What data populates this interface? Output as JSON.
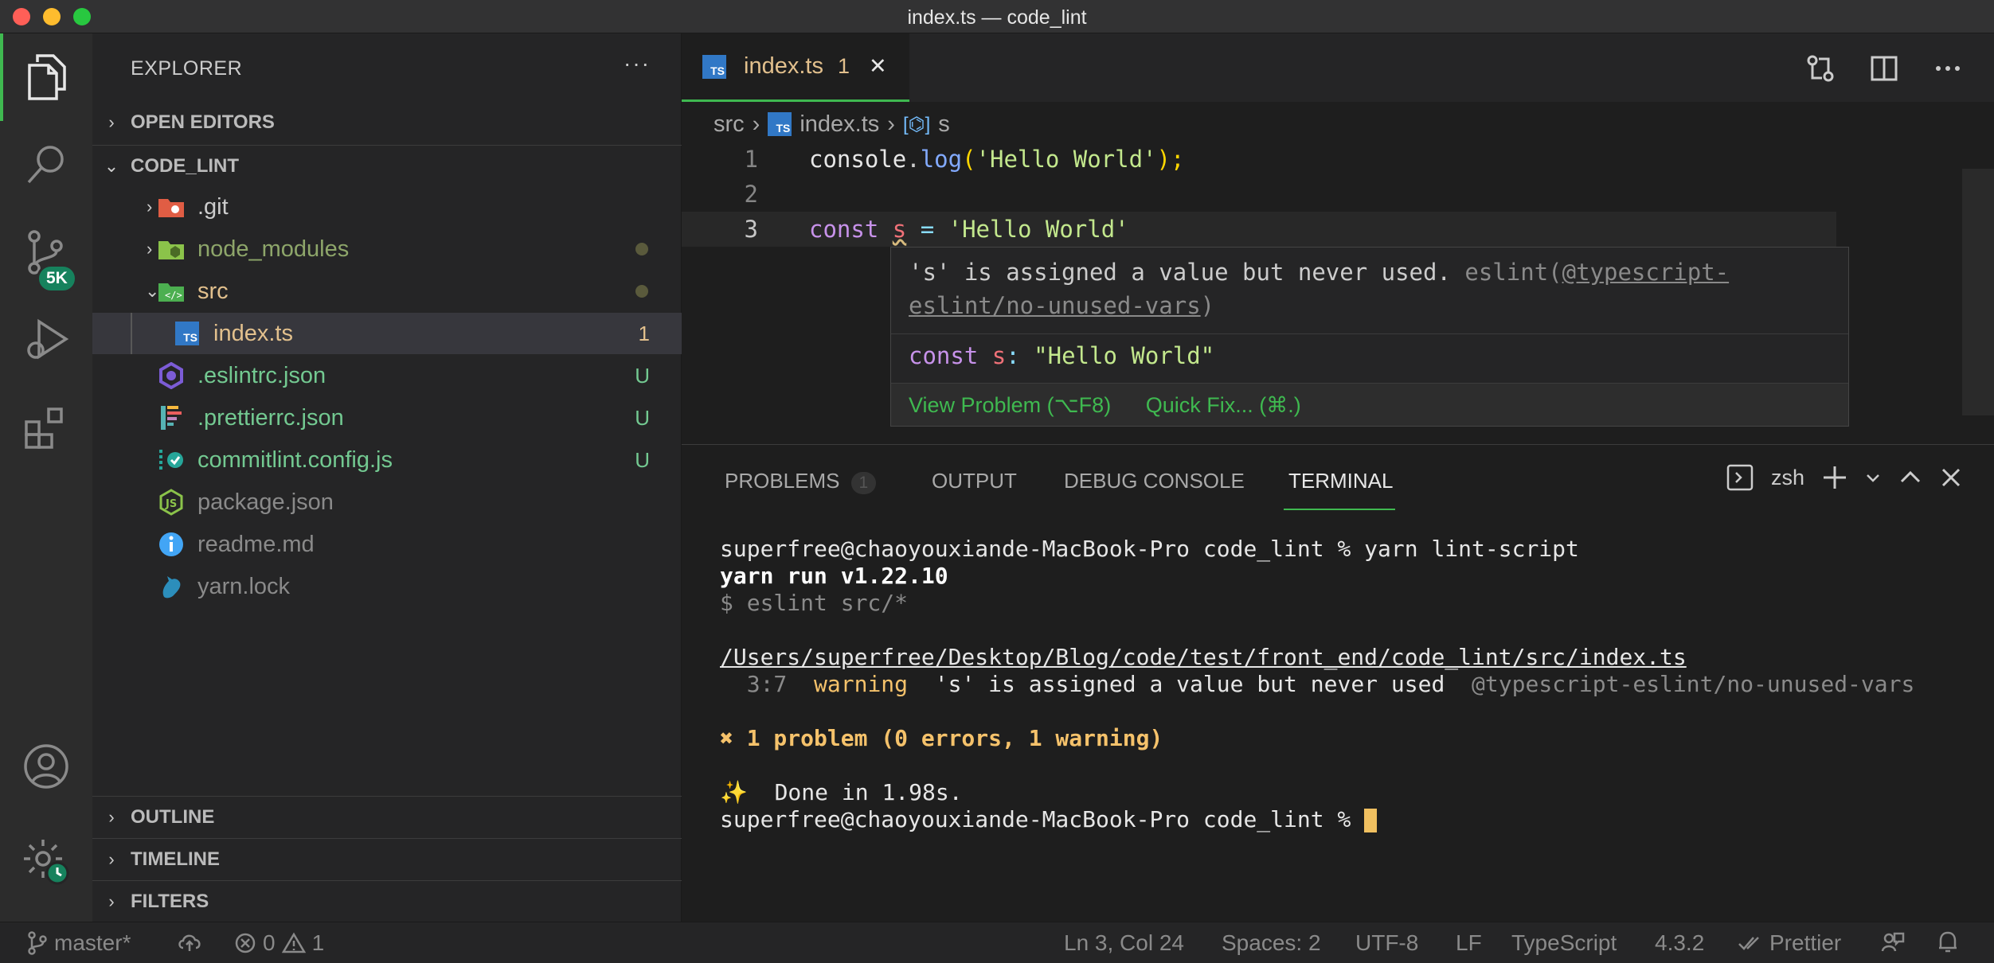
{
  "window": {
    "title": "index.ts — code_lint",
    "traffic_lights": [
      "#ff5f57",
      "#febc2e",
      "#28c840"
    ]
  },
  "activity_bar": {
    "items": [
      "explorer-icon",
      "search-icon",
      "source-control-icon",
      "run-debug-icon",
      "extensions-icon"
    ],
    "source_control_badge": "5K",
    "bottom": [
      "account-icon",
      "manage-icon"
    ]
  },
  "sidebar": {
    "title": "EXPLORER",
    "more": "···",
    "open_editors": "OPEN EDITORS",
    "project": "CODE_LINT",
    "tree": [
      {
        "name": ".git",
        "status": "",
        "color": "#cccccc"
      },
      {
        "name": "node_modules",
        "status": "",
        "color": "#8ea66a"
      },
      {
        "name": "src",
        "status": "",
        "color": "#e2c08d"
      },
      {
        "name": "index.ts",
        "status": "1",
        "color": "#e2c08d"
      },
      {
        "name": ".eslintrc.json",
        "status": "U",
        "color": "#73c991"
      },
      {
        "name": ".prettierrc.json",
        "status": "U",
        "color": "#73c991"
      },
      {
        "name": "commitlint.config.js",
        "status": "U",
        "color": "#73c991"
      },
      {
        "name": "package.json",
        "status": "",
        "color": "#8a8a8a"
      },
      {
        "name": "readme.md",
        "status": "",
        "color": "#8a8a8a"
      },
      {
        "name": "yarn.lock",
        "status": "",
        "color": "#8a8a8a"
      }
    ],
    "outline": "OUTLINE",
    "timeline": "TIMELINE",
    "filters": "FILTERS"
  },
  "editor": {
    "tab": {
      "icon_text": "TS",
      "name": "index.ts",
      "problems": "1",
      "close": "✕"
    },
    "breadcrumb": {
      "folder": "src",
      "file": "index.ts",
      "symbol": "s"
    },
    "lines": [
      {
        "num": "1"
      },
      {
        "num": "2"
      },
      {
        "num": "3"
      }
    ],
    "code": {
      "l1_console": "console",
      "l1_dot": ".",
      "l1_log": "log",
      "l1_open": "(",
      "l1_str": "'Hello World'",
      "l1_close": ");",
      "l3_const": "const",
      "l3_var": "s",
      "l3_eq": " = ",
      "l3_str": "'Hello World'"
    },
    "hover": {
      "message": "'s' is assigned a value but never used.",
      "source": "eslint(",
      "rule": "@typescript-eslint/no-unused-vars",
      "source_close": ")",
      "sig_const": "const",
      "sig_var": "s",
      "sig_colon": ": ",
      "sig_type": "\"Hello World\"",
      "view_problem": "View Problem (⌥F8)",
      "quick_fix": "Quick Fix... (⌘.)"
    }
  },
  "panel": {
    "tabs": [
      {
        "label": "PROBLEMS",
        "count": "1"
      },
      {
        "label": "OUTPUT"
      },
      {
        "label": "DEBUG CONSOLE"
      },
      {
        "label": "TERMINAL"
      }
    ],
    "active_tab": "TERMINAL",
    "shell": "zsh",
    "terminal": {
      "prompt1": "superfree@chaoyouxiande-MacBook-Pro code_lint % yarn lint-script",
      "yarn_run": "yarn run v1.22.10",
      "cmd": "$ eslint src/*",
      "file_path": "/Users/superfree/Desktop/Blog/code/test/front_end/code_lint/src/index.ts",
      "loc": "  3:7  ",
      "level": "warning",
      "warn_msg": "  's' is assigned a value but never used  ",
      "warn_rule": "@typescript-eslint/no-unused-vars",
      "summary": "✖ 1 problem (0 errors, 1 warning)",
      "done": "✨  Done in 1.98s.",
      "prompt2": "superfree@chaoyouxiande-MacBook-Pro code_lint % "
    }
  },
  "statusbar": {
    "branch": "master*",
    "errors": "0",
    "warnings": "1",
    "position": "Ln 3, Col 24",
    "spaces": "Spaces: 2",
    "encoding": "UTF-8",
    "eol": "LF",
    "language": "TypeScript",
    "ts_version": "4.3.2",
    "prettier": "Prettier"
  }
}
